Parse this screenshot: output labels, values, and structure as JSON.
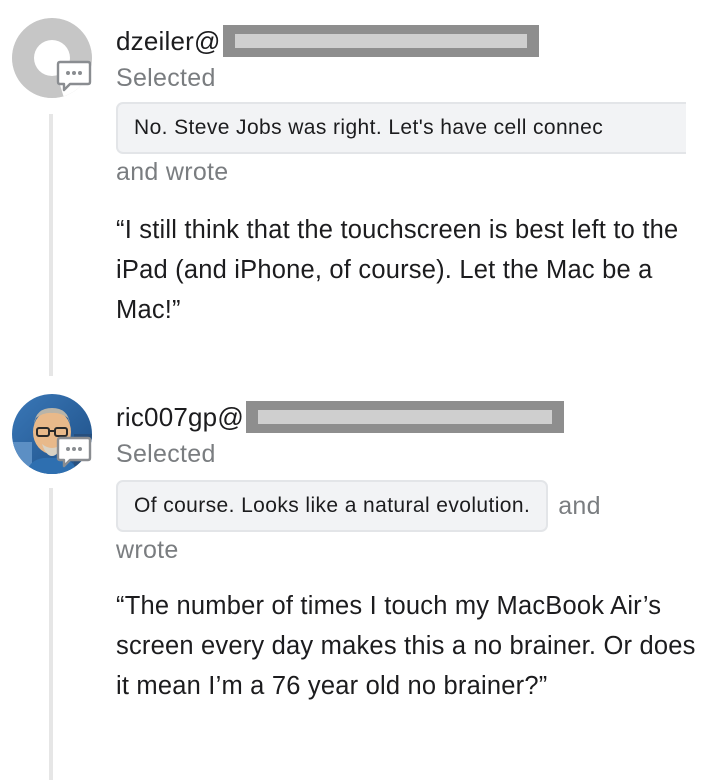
{
  "comments": [
    {
      "username": "dzeiler@",
      "selected_label": "Selected",
      "quoted_selection": "No. Steve Jobs was right. Let's have cell connec",
      "and_wrote": "and wrote",
      "body": "“I still think that the touchscreen is best left to the iPad (and iPhone, of course). Let the Mac be a Mac!”",
      "avatar": "default-avatar"
    },
    {
      "username": "ric007gp@",
      "selected_label": "Selected",
      "quoted_selection": "Of course. Looks like a natural evolution.",
      "and_label": "and",
      "wrote_label": "wrote",
      "body": "“The number of times I touch my MacBook Air’s screen every day makes this a no brainer. Or does it mean I’m a 76 year old no brainer?”",
      "avatar": "user-photo-avatar"
    }
  ],
  "icons": {
    "comment_badge": "speech-bubble-icon"
  },
  "colors": {
    "text_primary": "#1c1c1e",
    "text_secondary": "#7a7d80",
    "pill_bg": "#f2f3f5",
    "thread_line": "#e6e6e6",
    "redaction": "#8e8e8e"
  }
}
